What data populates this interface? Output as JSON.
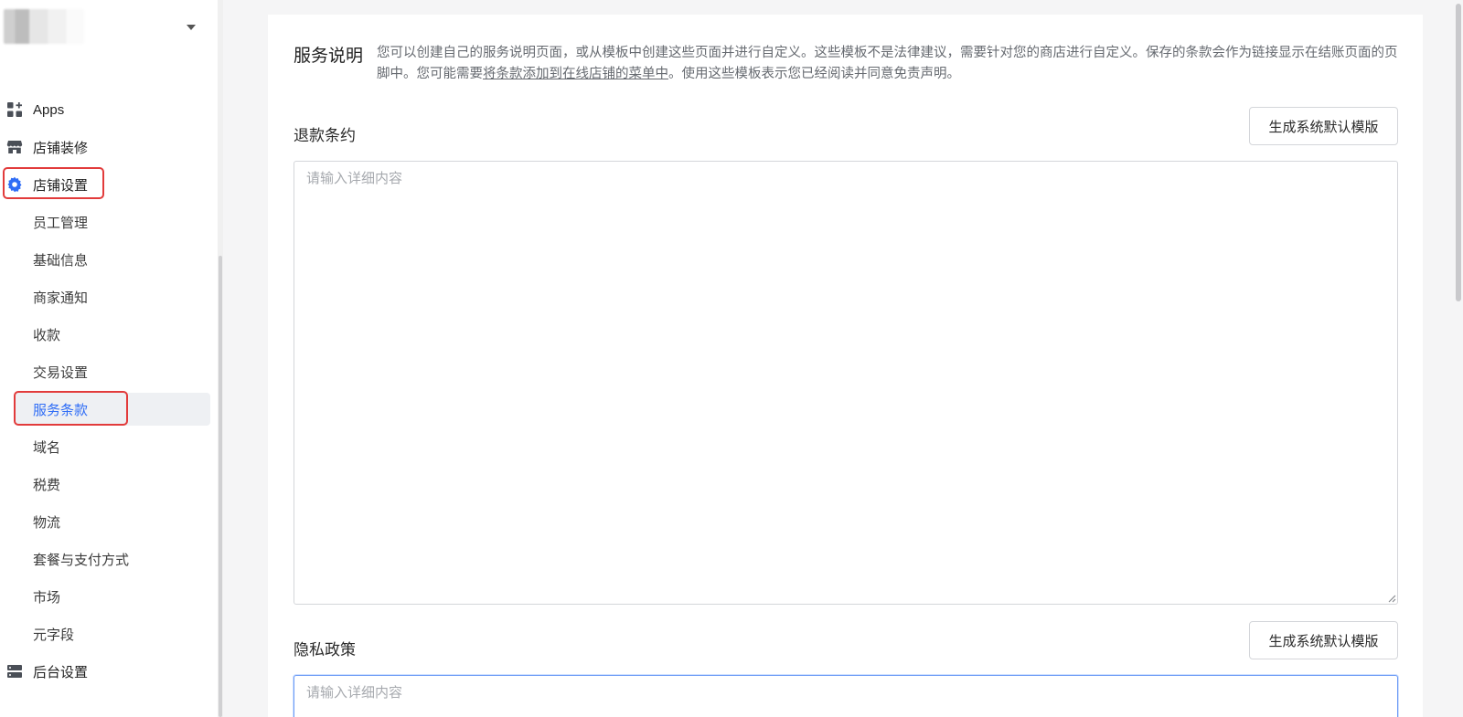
{
  "sidebar": {
    "main_items": [
      {
        "label": "Apps",
        "icon": "apps-grid-icon"
      },
      {
        "label": "店铺装修",
        "icon": "storefront-icon"
      },
      {
        "label": "店铺设置",
        "icon": "gear-icon"
      }
    ],
    "sub_items": [
      {
        "label": "员工管理"
      },
      {
        "label": "基础信息"
      },
      {
        "label": "商家通知"
      },
      {
        "label": "收款"
      },
      {
        "label": "交易设置"
      },
      {
        "label": "服务条款"
      },
      {
        "label": "域名"
      },
      {
        "label": "税费"
      },
      {
        "label": "物流"
      },
      {
        "label": "套餐与支付方式"
      },
      {
        "label": "市场"
      },
      {
        "label": "元字段"
      }
    ],
    "bottom_item": {
      "label": "后台设置",
      "icon": "server-icon"
    },
    "active_sub": "服务条款"
  },
  "intro": {
    "title": "服务说明",
    "text_before": "您可以创建自己的服务说明页面，或从模板中创建这些页面并进行自定义。这些模板不是法律建议，需要针对您的商店进行自定义。保存的条款会作为链接显示在结账页面的页脚中。您可能需要",
    "link": "将条款添加到在线店铺的菜单中",
    "text_after": "。使用这些模板表示您已经阅读并同意免责声明。"
  },
  "sections": [
    {
      "title": "退款条约",
      "button": "生成系统默认模版",
      "placeholder": "请输入详细内容",
      "value": ""
    },
    {
      "title": "隐私政策",
      "button": "生成系统默认模版",
      "placeholder": "请输入详细内容",
      "value": ""
    }
  ],
  "colors": {
    "accent": "#2f6df6",
    "highlight": "#e23b3b",
    "gear_icon": "#2f6df6"
  }
}
